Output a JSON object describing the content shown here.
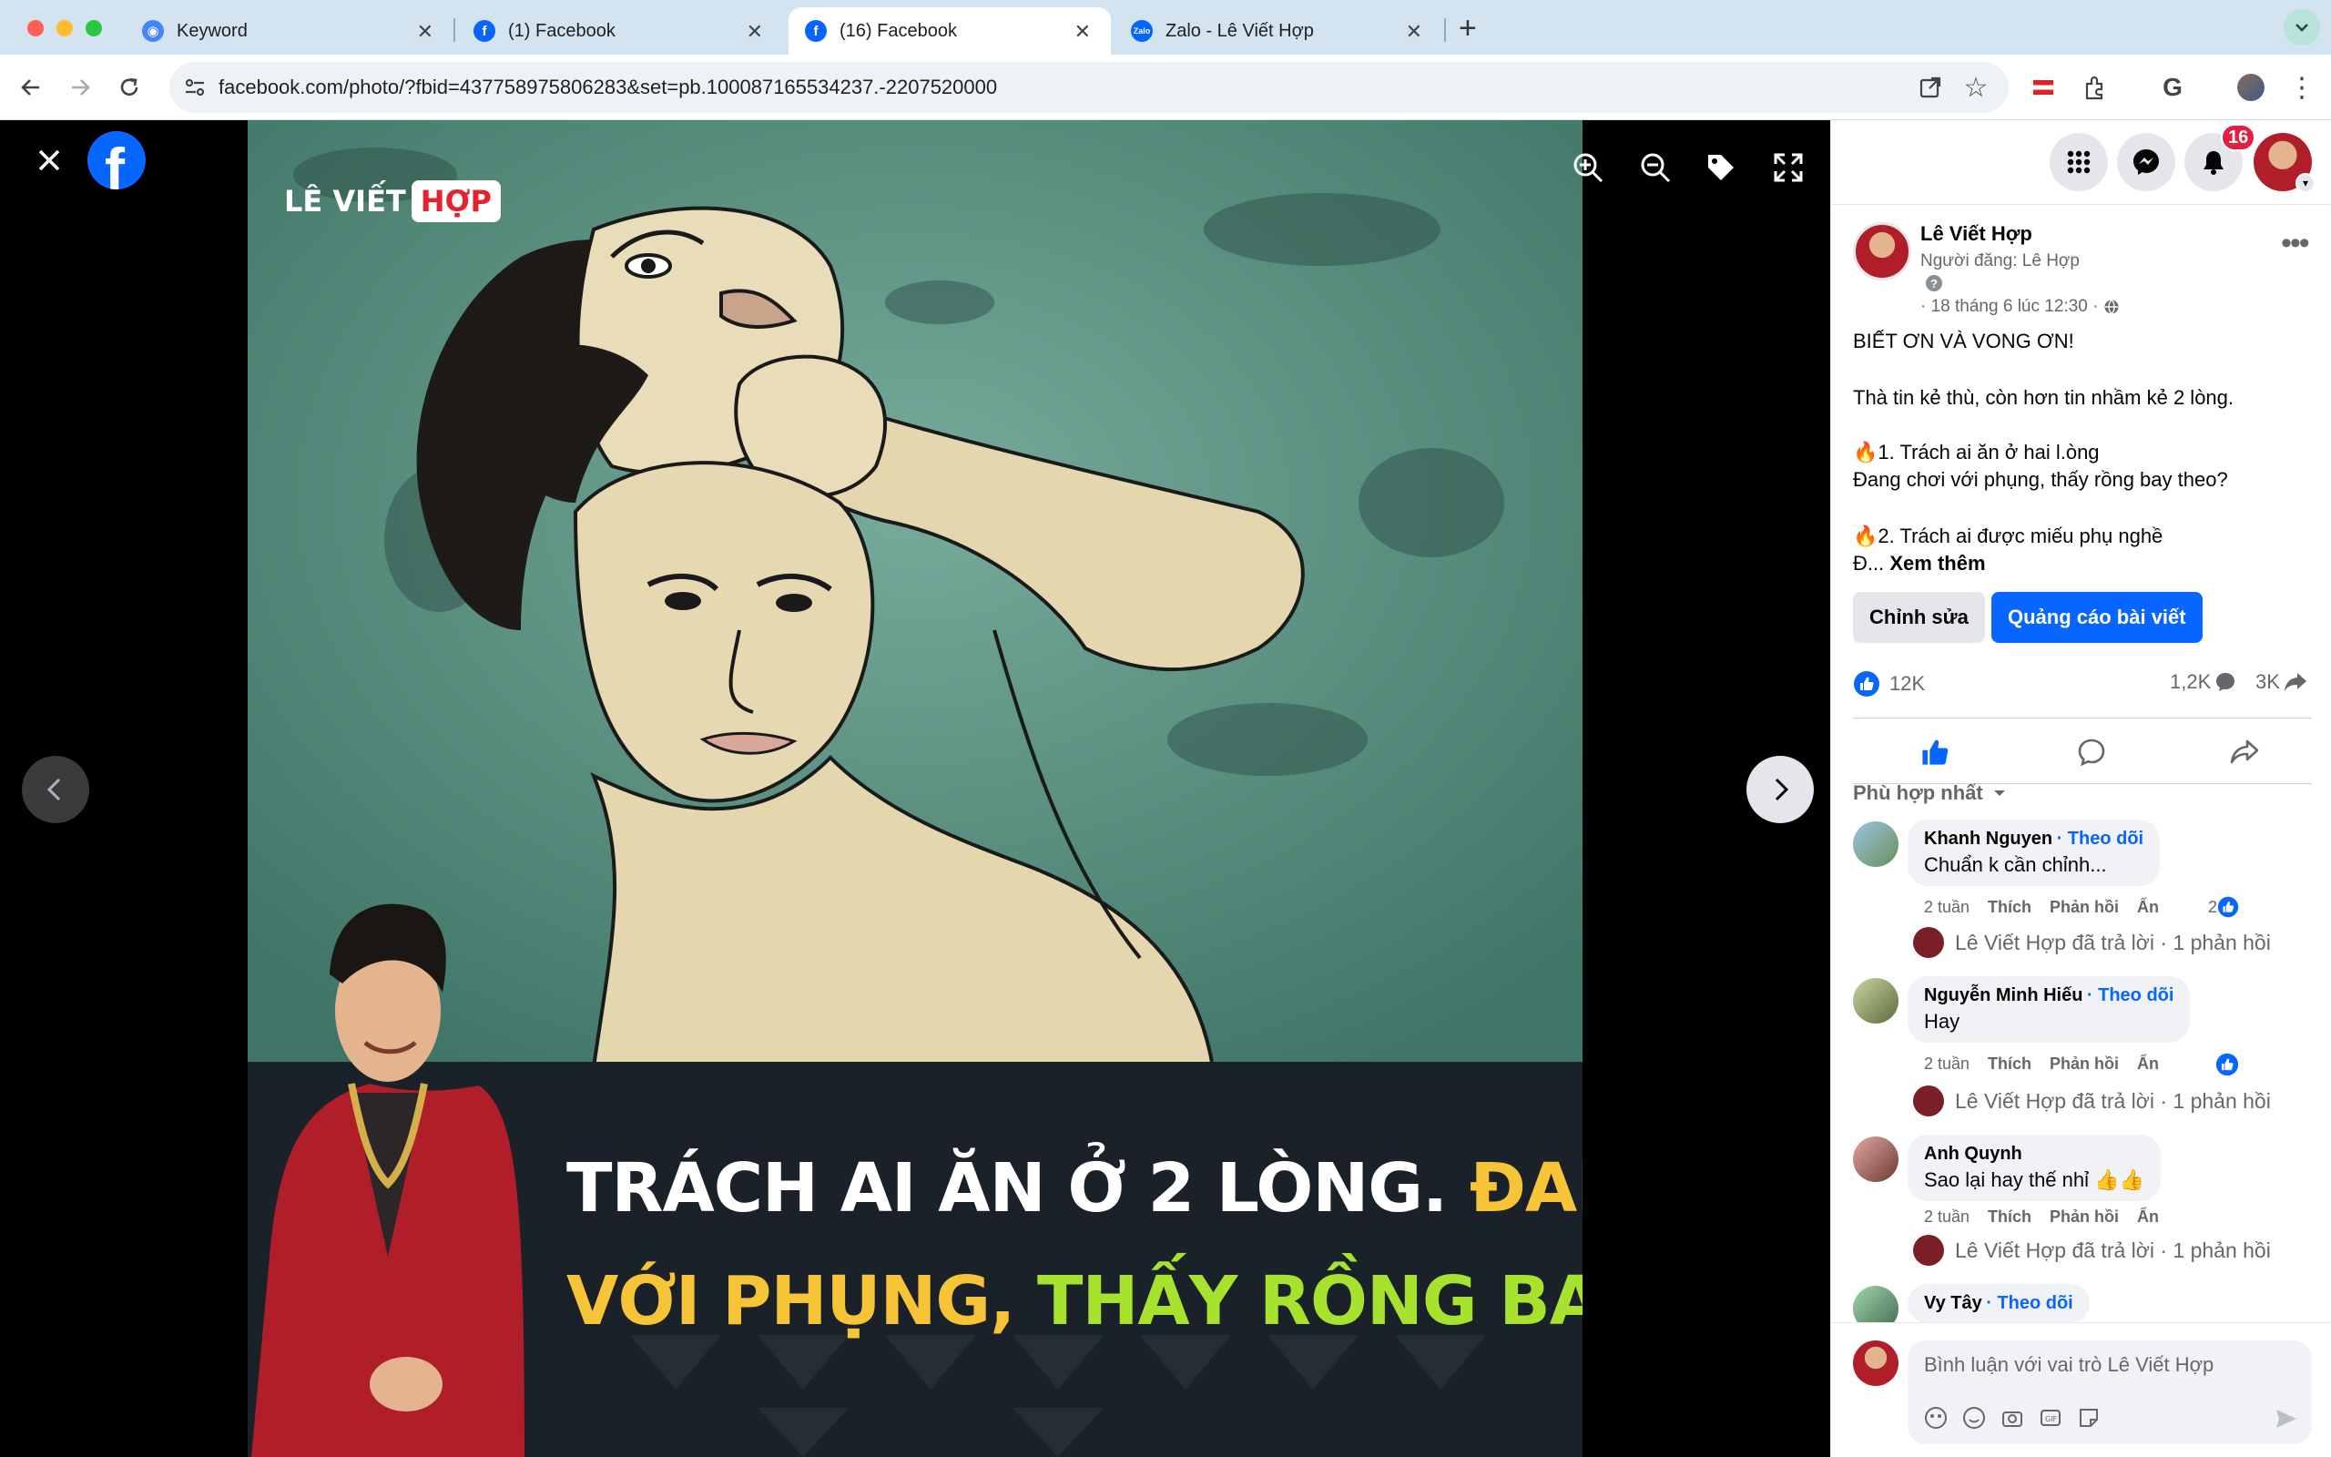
{
  "browser": {
    "tabs": [
      {
        "title": "Keyword",
        "favicon_color": "#4285f4",
        "active": false
      },
      {
        "title": "(1) Facebook",
        "favicon_color": "#0866ff",
        "active": false
      },
      {
        "title": "(16) Facebook",
        "favicon_color": "#0866ff",
        "active": true
      },
      {
        "title": "Zalo - Lê Viết Hợp",
        "favicon_color": "#0068ff",
        "active": false
      }
    ],
    "new_tab": "+",
    "url": "facebook.com/photo/?fbid=437758975806283&set=pb.100087165534237.-2207520000",
    "favicon_letter": "f",
    "zalo_badge": "Zalo"
  },
  "viewer": {
    "logo_text": "LÊ VIẾT",
    "logo_accent": "HỢP",
    "headline_line1_white": "TRÁCH AI ĂN Ở 2 LÒNG.",
    "headline_line1_yellow": "ĐANG CHƠI",
    "headline_line2_yellow": "VỚI PHỤNG,",
    "headline_line2_green": "THẤY RỒNG BAY THEO",
    "colors": {
      "yellow": "#f7c437",
      "green": "#a6e22e",
      "accent_red": "#e52330",
      "bg_teal": "#5f9a8c"
    }
  },
  "header": {
    "notification_count": "16"
  },
  "post": {
    "author": "Lê Viết Hợp",
    "posted_by": "Người đăng: Lê Hợp",
    "help_mark": "?",
    "timestamp": "· 18 tháng 6 lúc 12:30 ·",
    "title_line": "BIẾT ƠN VÀ VONG ƠN!",
    "line2": "Thà tin kẻ thù, còn hơn tin nhầm kẻ 2 lòng.",
    "line3": "1. Trách ai ăn ở hai l.òng",
    "line4": "Đang chơi với phụng, thấy rồng bay theo?",
    "line5": "2. Trách ai được miếu phụ nghề",
    "line6_prefix": "Đ...",
    "see_more": "Xem thêm",
    "edit_button": "Chỉnh sửa",
    "promote_button": "Quảng cáo bài viết",
    "likes": "12K",
    "comments": "1,2K",
    "shares": "3K",
    "sort_label": "Phù hợp nhất"
  },
  "comments": [
    {
      "name": "Khanh Nguyen",
      "follow": "· Theo dõi",
      "text": "Chuẩn k cần chỉnh...",
      "time": "2 tuần",
      "like": "Thích",
      "reply": "Phản hồi",
      "hide": "Ẩn",
      "reaction_count": "2",
      "reply_summary": "Lê Viết Hợp đã trả lời · 1 phản hồi"
    },
    {
      "name": "Nguyễn Minh Hiếu",
      "follow": "· Theo dõi",
      "text": "Hay",
      "time": "2 tuần",
      "like": "Thích",
      "reply": "Phản hồi",
      "hide": "Ẩn",
      "reaction_count": "",
      "reply_summary": "Lê Viết Hợp đã trả lời · 1 phản hồi"
    },
    {
      "name": "Anh Quynh",
      "follow": "",
      "text": "Sao lại hay thế nhỉ 👍👍",
      "time": "2 tuần",
      "like": "Thích",
      "reply": "Phản hồi",
      "hide": "Ẩn",
      "reaction_count": "",
      "reply_summary": "Lê Viết Hợp đã trả lời · 1 phản hồi"
    },
    {
      "name": "Vy Tây",
      "follow": "· Theo dõi",
      "text": "",
      "time": "",
      "like": "",
      "reply": "",
      "hide": "",
      "reaction_count": "",
      "reply_summary": ""
    }
  ],
  "composer": {
    "placeholder": "Bình luận với vai trò Lê Viết Hợp"
  }
}
